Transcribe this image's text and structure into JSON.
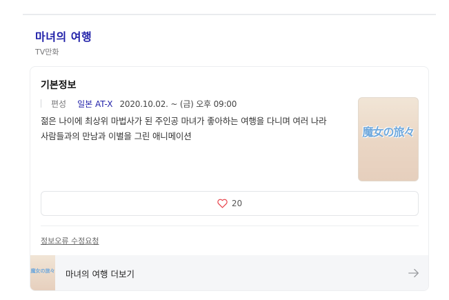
{
  "header": {
    "title": "마녀의 여행",
    "category": "TV만화"
  },
  "info": {
    "section_title": "기본정보",
    "broadcast_label": "편성",
    "broadcast_link": "일본 AT-X",
    "broadcast_date": "2020.10.02. ~ (금) 오후 09:00",
    "description": "젊은 나이에 최상위 마법사가 된 주인공 마녀가 좋아하는 여행을 다니며 여러 나라 사람들과의 만남과 이별을 그린 애니메이션",
    "poster_logo": "魔女の旅々"
  },
  "like": {
    "count": "20",
    "icon": "heart-outline-icon",
    "color": "#e8474f"
  },
  "report": {
    "label": "정보오류 수정요청"
  },
  "more": {
    "label": "마녀의 여행 더보기",
    "thumb_logo": "魔女の旅々",
    "icon": "arrow-right-icon"
  },
  "colors": {
    "title": "#1f1fa8",
    "link": "#1f1fa8"
  }
}
